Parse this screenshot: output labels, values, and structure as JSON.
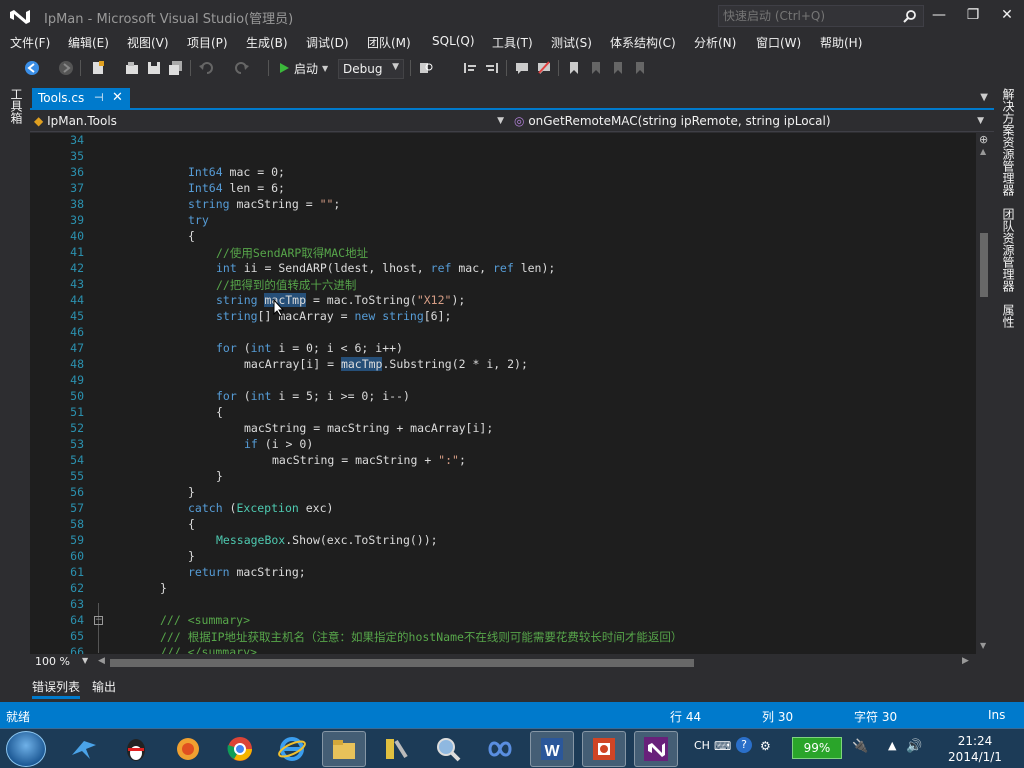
{
  "window": {
    "title": "IpMan - Microsoft Visual Studio(管理员)",
    "quick_launch_placeholder": "快速启动 (Ctrl+Q)",
    "min_label": "—",
    "restore_label": "❐",
    "close_label": "✕"
  },
  "menu": [
    "文件(F)",
    "编辑(E)",
    "视图(V)",
    "项目(P)",
    "生成(B)",
    "调试(D)",
    "团队(M)",
    "SQL(Q)",
    "工具(T)",
    "测试(S)",
    "体系结构(C)",
    "分析(N)",
    "窗口(W)",
    "帮助(H)"
  ],
  "toolbar": {
    "start_label": "启动",
    "config": "Debug"
  },
  "side_panels": {
    "left": "工具箱",
    "right": [
      "解决方案资源管理器",
      "团队资源管理器",
      "属性"
    ]
  },
  "doc_tab": {
    "name": "Tools.cs",
    "pin": "⊣",
    "close": "✕"
  },
  "nav": {
    "class": "IpMan.Tools",
    "member": "onGetRemoteMAC(string ipRemote, string ipLocal)"
  },
  "editor": {
    "line_numbers": [
      "34",
      "35",
      "36",
      "37",
      "38",
      "39",
      "40",
      "41",
      "42",
      "43",
      "44",
      "45",
      "46",
      "47",
      "48",
      "49",
      "50",
      "51",
      "52",
      "53",
      "54",
      "55",
      "56",
      "57",
      "58",
      "59",
      "60",
      "61",
      "62",
      "63",
      "64",
      "65",
      "66"
    ],
    "zoom": "100 %"
  },
  "bottom_tabs": [
    "错误列表",
    "输出"
  ],
  "status": {
    "state": "就绪",
    "line": "行 44",
    "col": "列 30",
    "char": "字符 30",
    "mode": "Ins"
  },
  "taskbar": {
    "lang": "CH",
    "battery": "99%",
    "time": "21:24",
    "date": "2014/1/1"
  },
  "colors": {
    "accent": "#007acc",
    "editor_bg": "#1e1e1e",
    "chrome_bg": "#2d2d30",
    "keyword": "#569cd6",
    "type": "#4ec9b0",
    "string": "#d69d85",
    "comment": "#57a64a",
    "line_number": "#2b91af"
  }
}
